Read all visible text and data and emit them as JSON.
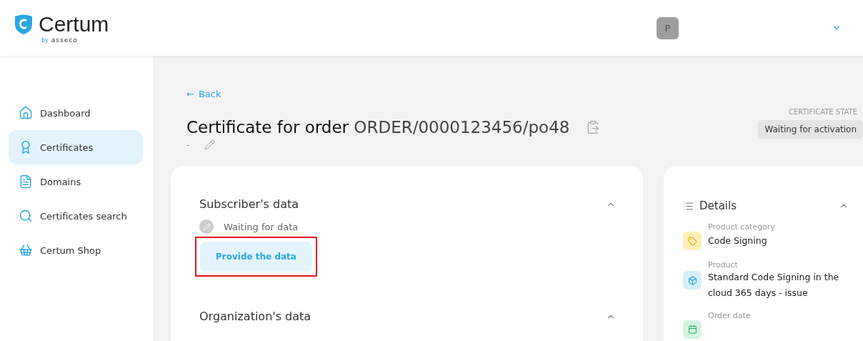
{
  "logo": {
    "name": "Certum",
    "by": "by",
    "maker": "asseco"
  },
  "user": {
    "initial": "P"
  },
  "sidebar": {
    "items": [
      {
        "label": "Dashboard",
        "kind": "home",
        "selected": false
      },
      {
        "label": "Certificates",
        "kind": "award",
        "selected": true
      },
      {
        "label": "Domains",
        "kind": "file",
        "selected": false
      },
      {
        "label": "Certificates search",
        "kind": "search",
        "selected": false
      },
      {
        "label": "Certum Shop",
        "kind": "basket",
        "selected": false
      }
    ]
  },
  "back": {
    "arrow": "←",
    "label": "Back"
  },
  "title": {
    "prefix": "Certificate for order",
    "order": "ORDER/0000123456/po48",
    "subtitle": "-"
  },
  "state": {
    "label": "CERTIFICATE STATE",
    "value": "Waiting for activation"
  },
  "sections": [
    {
      "title": "Subscriber's data",
      "expanded": true,
      "status": "Waiting for data",
      "button": "Provide the data",
      "highlighted": true
    },
    {
      "title": "Organization's data",
      "expanded": true
    }
  ],
  "details": {
    "title": "Details",
    "expanded": true,
    "items": [
      {
        "label": "Product category",
        "value": "Code Signing",
        "kind": "tag",
        "color": "#fff0b8"
      },
      {
        "label": "Product",
        "value": "Standard Code Signing in the cloud 365 days - issue",
        "kind": "box",
        "color": "#d6f0fb"
      },
      {
        "label": "Order date",
        "kind": "calendar",
        "color": "#d5f3e2"
      }
    ]
  }
}
